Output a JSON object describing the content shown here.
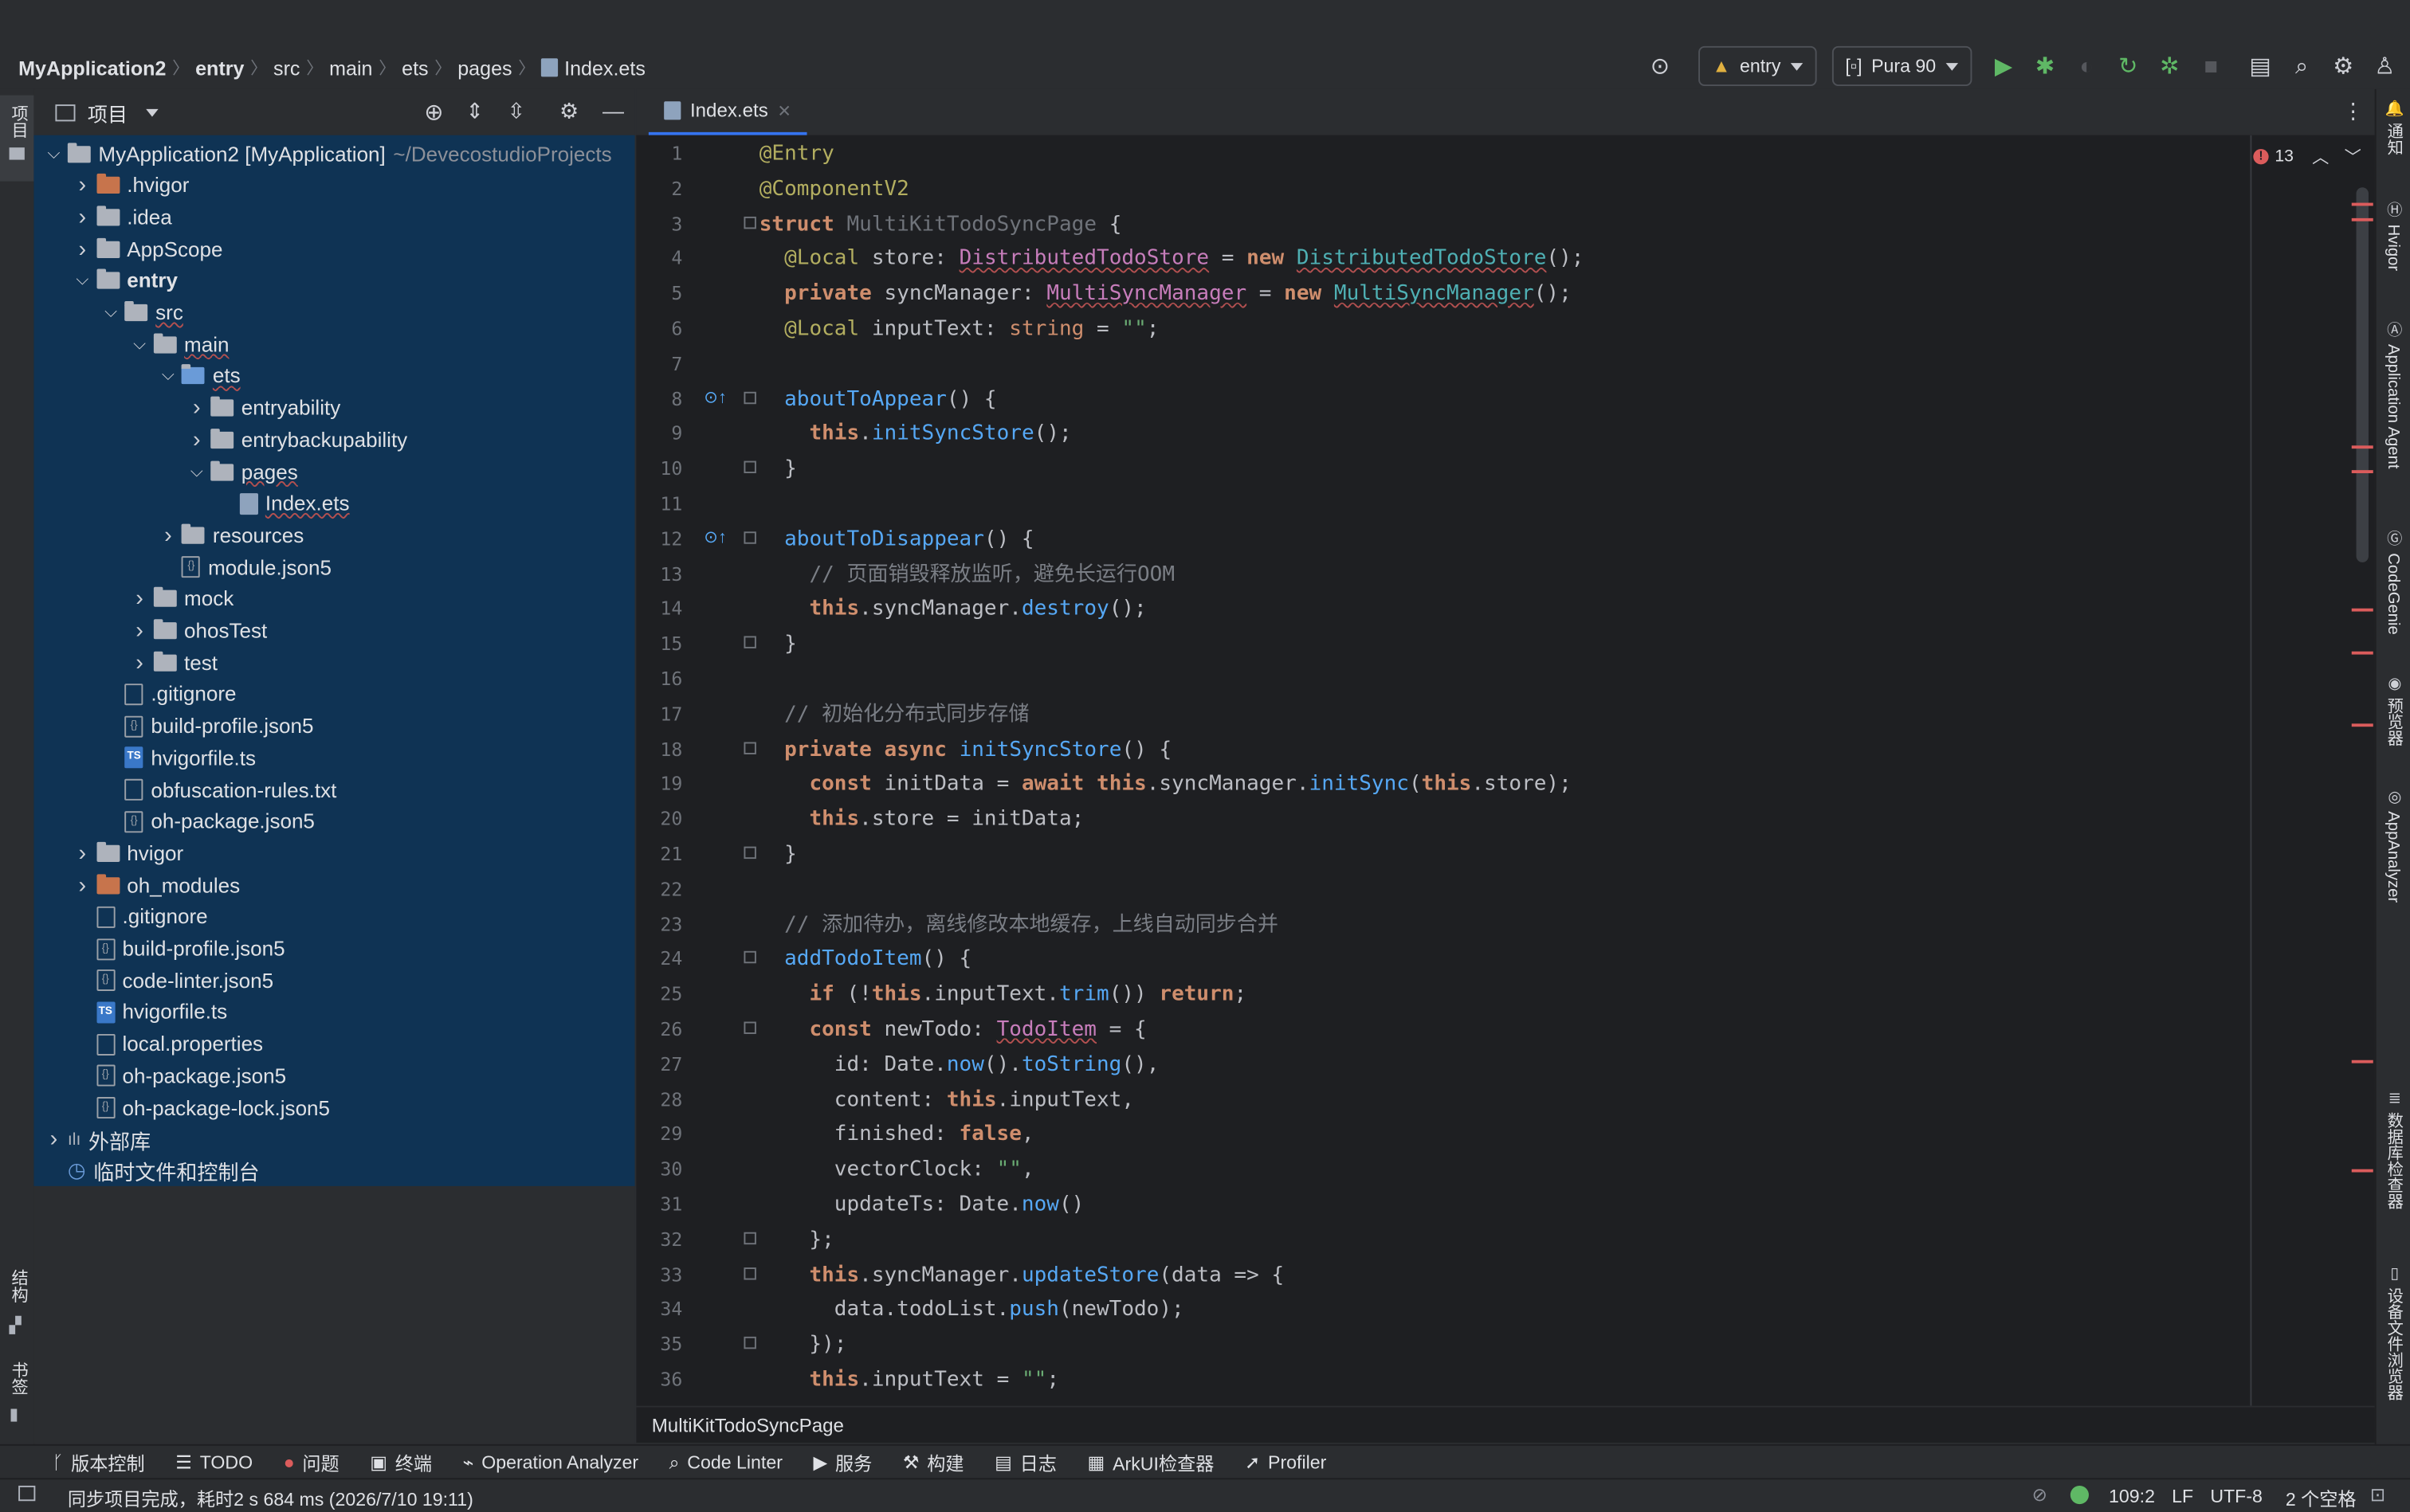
{
  "breadcrumb": [
    "MyApplication2",
    "entry",
    "src",
    "main",
    "ets",
    "pages",
    "Index.ets"
  ],
  "toolbar": {
    "run_config": "entry",
    "device": "Pura 90"
  },
  "left_stripe": {
    "project": "项目",
    "structure": "结构",
    "bookmarks": "书签"
  },
  "project_panel": {
    "title": "项目"
  },
  "tree": [
    {
      "label": "MyApplication2 [MyApplication]",
      "extra": "~/DevecostudioProjects",
      "depth": 0,
      "icon": "module",
      "open": true
    },
    {
      "label": ".hvigor",
      "depth": 1,
      "icon": "folder-orange",
      "open": false
    },
    {
      "label": ".idea",
      "depth": 1,
      "icon": "folder",
      "open": false
    },
    {
      "label": "AppScope",
      "depth": 1,
      "icon": "folder",
      "open": false
    },
    {
      "label": "entry",
      "depth": 1,
      "icon": "module",
      "open": true
    },
    {
      "label": "src",
      "depth": 2,
      "icon": "folder",
      "open": true
    },
    {
      "label": "main",
      "depth": 3,
      "icon": "folder",
      "open": true
    },
    {
      "label": "ets",
      "depth": 4,
      "icon": "folder-blue",
      "open": true
    },
    {
      "label": "entryability",
      "depth": 5,
      "icon": "folder",
      "open": false
    },
    {
      "label": "entrybackupability",
      "depth": 5,
      "icon": "folder",
      "open": false
    },
    {
      "label": "pages",
      "depth": 5,
      "icon": "folder",
      "open": true
    },
    {
      "label": "Index.ets",
      "depth": 6,
      "icon": "file-ets",
      "open": null
    },
    {
      "label": "resources",
      "depth": 4,
      "icon": "folder",
      "open": false
    },
    {
      "label": "module.json5",
      "depth": 4,
      "icon": "file-json",
      "open": null
    },
    {
      "label": "mock",
      "depth": 3,
      "icon": "folder",
      "open": false
    },
    {
      "label": "ohosTest",
      "depth": 3,
      "icon": "folder",
      "open": false
    },
    {
      "label": "test",
      "depth": 3,
      "icon": "folder",
      "open": false
    },
    {
      "label": ".gitignore",
      "depth": 2,
      "icon": "file",
      "open": null
    },
    {
      "label": "build-profile.json5",
      "depth": 2,
      "icon": "file-json",
      "open": null
    },
    {
      "label": "hvigorfile.ts",
      "depth": 2,
      "icon": "file-ts",
      "open": null
    },
    {
      "label": "obfuscation-rules.txt",
      "depth": 2,
      "icon": "file",
      "open": null
    },
    {
      "label": "oh-package.json5",
      "depth": 2,
      "icon": "file-json",
      "open": null
    },
    {
      "label": "hvigor",
      "depth": 1,
      "icon": "folder",
      "open": false
    },
    {
      "label": "oh_modules",
      "depth": 1,
      "icon": "folder-orange",
      "open": false
    },
    {
      "label": ".gitignore",
      "depth": 1,
      "icon": "file",
      "open": null
    },
    {
      "label": "build-profile.json5",
      "depth": 1,
      "icon": "file-json",
      "open": null
    },
    {
      "label": "code-linter.json5",
      "depth": 1,
      "icon": "file-json",
      "open": null
    },
    {
      "label": "hvigorfile.ts",
      "depth": 1,
      "icon": "file-ts",
      "open": null
    },
    {
      "label": "local.properties",
      "depth": 1,
      "icon": "file",
      "open": null
    },
    {
      "label": "oh-package.json5",
      "depth": 1,
      "icon": "file-json",
      "open": null
    },
    {
      "label": "oh-package-lock.json5",
      "depth": 1,
      "icon": "file-json",
      "open": null
    },
    {
      "label": "外部库",
      "depth": 0,
      "icon": "library",
      "open": false
    },
    {
      "label": "临时文件和控制台",
      "depth": 0,
      "icon": "scratch",
      "open": null
    }
  ],
  "editor": {
    "tab": "Index.ets",
    "error_count": "13",
    "footer_crumb": "MultiKitTodoSyncPage",
    "line_numbers": [
      "1",
      "2",
      "3",
      "4",
      "5",
      "6",
      "7",
      "8",
      "9",
      "10",
      "11",
      "12",
      "13",
      "14",
      "15",
      "16",
      "17",
      "18",
      "19",
      "20",
      "21",
      "22",
      "23",
      "24",
      "25",
      "26",
      "27",
      "28",
      "29",
      "30",
      "31",
      "32",
      "33",
      "34",
      "35",
      "36"
    ],
    "lines": [
      "@Entry",
      "@ComponentV2",
      "struct MultiKitTodoSyncPage {",
      "  @Local store: DistributedTodoStore = new DistributedTodoStore();",
      "  private syncManager: MultiSyncManager = new MultiSyncManager();",
      "  @Local inputText: string = \"\";",
      "",
      "  aboutToAppear() {",
      "    this.initSyncStore();",
      "  }",
      "",
      "  aboutToDisappear() {",
      "    // 页面销毁释放监听，避免长运行OOM",
      "    this.syncManager.destroy();",
      "  }",
      "",
      "  // 初始化分布式同步存储",
      "  private async initSyncStore() {",
      "    const initData = await this.syncManager.initSync(this.store);",
      "    this.store = initData;",
      "  }",
      "",
      "  // 添加待办，离线修改本地缓存，上线自动同步合并",
      "  addTodoItem() {",
      "    if (!this.inputText.trim()) return;",
      "    const newTodo: TodoItem = {",
      "      id: Date.now().toString(),",
      "      content: this.inputText,",
      "      finished: false,",
      "      vectorClock: \"\",",
      "      updateTs: Date.now()",
      "    };",
      "    this.syncManager.updateStore(data => {",
      "      data.todoList.push(newTodo);",
      "    });",
      "    this.inputText = \"\";"
    ]
  },
  "right_stripe": [
    "通知",
    "Hvigor",
    "Application Agent",
    "CodeGenie",
    "预览器",
    "AppAnalyzer",
    "数据库检查器",
    "设备文件浏览器"
  ],
  "tool_windows": [
    "版本控制",
    "TODO",
    "问题",
    "终端",
    "Operation Analyzer",
    "Code Linter",
    "服务",
    "构建",
    "日志",
    "ArkUI检查器",
    "Profiler"
  ],
  "status": {
    "message": "同步项目完成，耗时2 s 684 ms (2026/7/10 19:11)",
    "position": "109:2",
    "line_ending": "LF",
    "encoding": "UTF-8",
    "indent": "2 个空格"
  },
  "colors": {
    "accent": "#3574f0",
    "tree_selection": "#0f3354",
    "error": "#db5c5c",
    "run_green": "#5fb865"
  }
}
